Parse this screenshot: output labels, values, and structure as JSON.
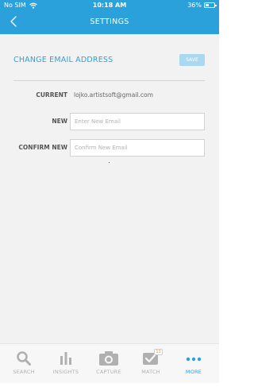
{
  "status_bar": {
    "carrier": "No SIM",
    "time": "10:18 AM",
    "battery": "36%",
    "battery_level": 0.36
  },
  "header": {
    "title": "SETTINGS"
  },
  "section": {
    "title": "CHANGE EMAIL ADDRESS",
    "save_label": "SAVE"
  },
  "form": {
    "current_label": "CURRENT",
    "current_value": "lojko.artistsoft@gmail.com",
    "new_label": "NEW",
    "new_value": "",
    "new_placeholder": "Enter New Email",
    "confirm_label": "CONFIRM NEW",
    "confirm_value": "",
    "confirm_placeholder": "Confirm New Email"
  },
  "tabs": [
    {
      "label": "SEARCH",
      "icon": "search-icon",
      "active": false
    },
    {
      "label": "INSIGHTS",
      "icon": "bar-chart-icon",
      "active": false
    },
    {
      "label": "CAPTURE",
      "icon": "camera-icon",
      "active": false
    },
    {
      "label": "MATCH",
      "icon": "checkmark-icon",
      "active": false,
      "badge": "11"
    },
    {
      "label": "MORE",
      "icon": "ellipsis-icon",
      "active": true
    }
  ],
  "colors": {
    "accent": "#2ba1dc",
    "save_disabled": "#a9d8f1",
    "inactive_tab": "#b0b0b0",
    "background": "#f2f2f2"
  }
}
